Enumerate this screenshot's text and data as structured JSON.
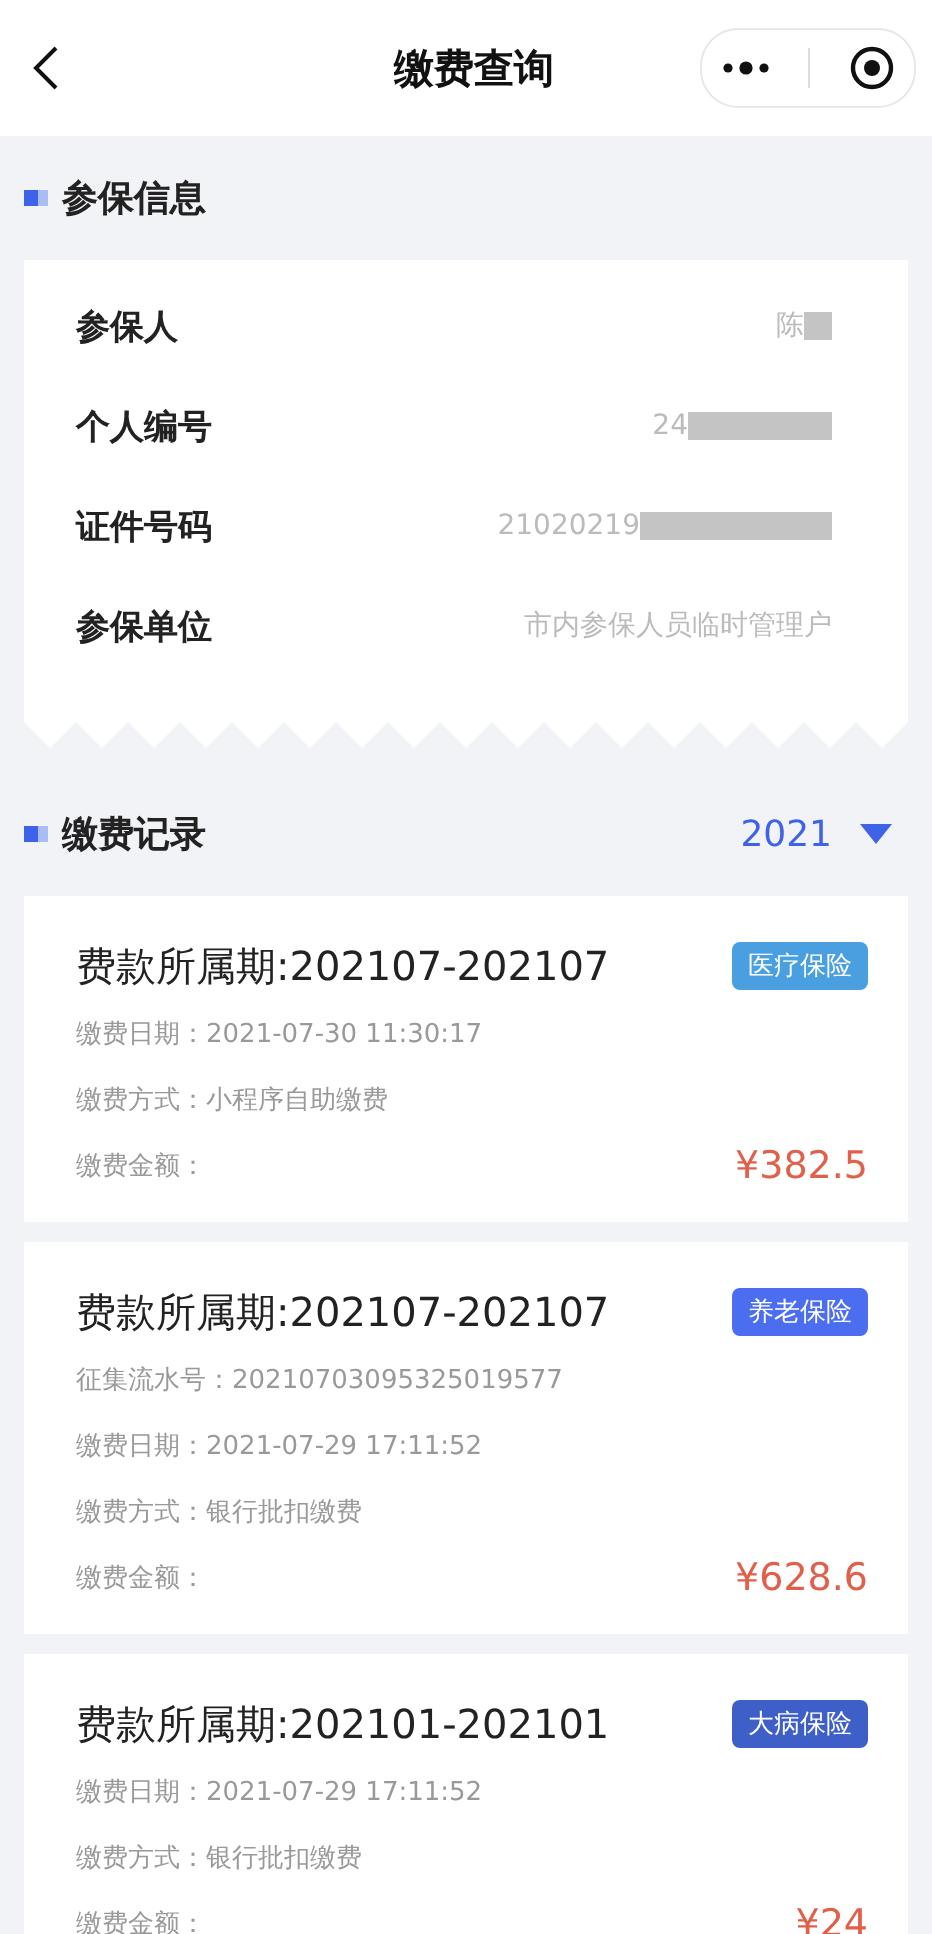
{
  "nav": {
    "title": "缴费查询"
  },
  "insured_info": {
    "title": "参保信息",
    "rows": [
      {
        "label": "参保人",
        "value": "陈",
        "redacted": true
      },
      {
        "label": "个人编号",
        "value": "24",
        "redacted": true
      },
      {
        "label": "证件号码",
        "value": "21020219",
        "redacted": true
      },
      {
        "label": "参保单位",
        "value": "市内参保人员临时管理户",
        "redacted": false
      }
    ]
  },
  "records": {
    "title": "缴费记录",
    "year": "2021",
    "items": [
      {
        "period": "费款所属期:202107-202107",
        "tag": "医疗保险",
        "color": "#4a9fe0",
        "fields": [
          {
            "label": "缴费日期：",
            "value": "2021-07-30 11:30:17"
          },
          {
            "label": "缴费方式：",
            "value": "小程序自助缴费"
          }
        ],
        "amount_label": "缴费金额：",
        "amount": "¥382.5"
      },
      {
        "period": "费款所属期:202107-202107",
        "tag": "养老保险",
        "color": "#4b6ef0",
        "fields": [
          {
            "label": "征集流水号：",
            "value": "20210703095325019577"
          },
          {
            "label": "缴费日期：",
            "value": "2021-07-29 17:11:52"
          },
          {
            "label": "缴费方式：",
            "value": "银行批扣缴费"
          }
        ],
        "amount_label": "缴费金额：",
        "amount": "¥628.6"
      },
      {
        "period": "费款所属期:202101-202101",
        "tag": "大病保险",
        "color": "#3f5fc8",
        "fields": [
          {
            "label": "缴费日期：",
            "value": "2021-07-29 17:11:52"
          },
          {
            "label": "缴费方式：",
            "value": "银行批扣缴费"
          }
        ],
        "amount_label": "缴费金额：",
        "amount": "¥24"
      }
    ]
  }
}
